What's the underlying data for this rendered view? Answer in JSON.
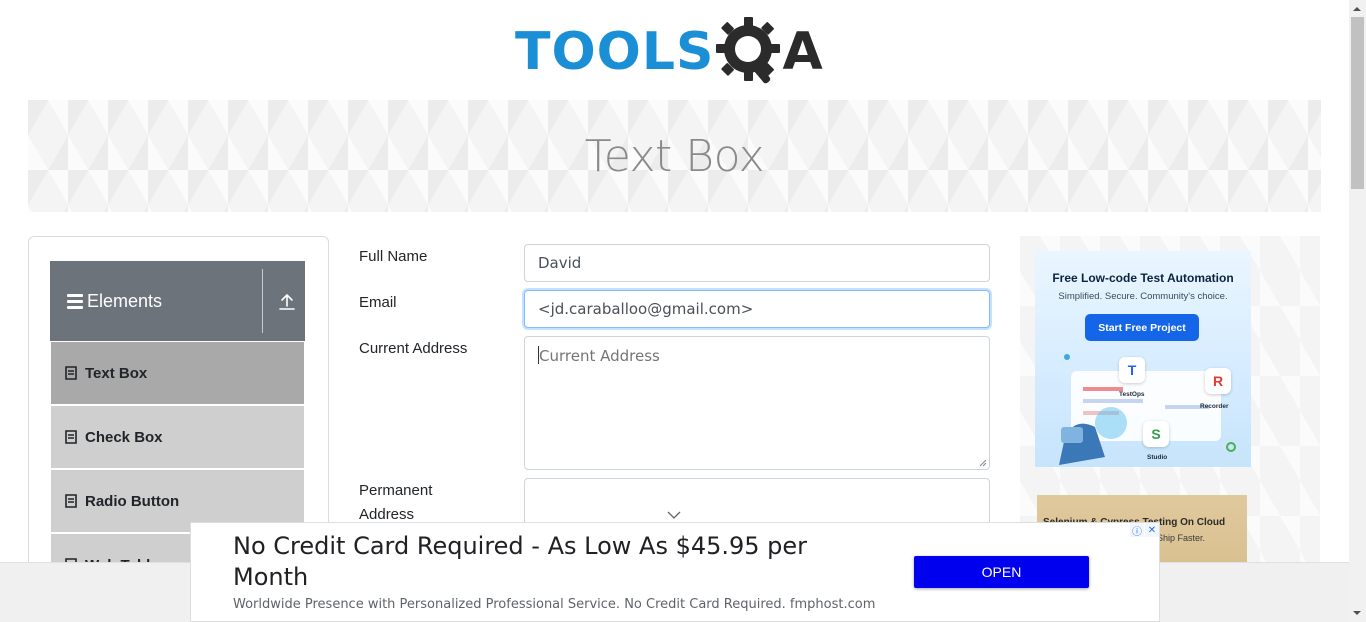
{
  "header": {
    "logo": {
      "text_left": "TOOLS",
      "text_right": "A",
      "icon": "gear-magnifier-icon",
      "colors": {
        "blue": "#1a8fd5",
        "dark": "#2b2b2b"
      }
    }
  },
  "banner": {
    "title": "Text Box"
  },
  "sidebar": {
    "group": {
      "title": "Elements",
      "icon": "hamburger-icon",
      "collapse_icon": "upload-arrow-icon"
    },
    "items": [
      {
        "label": "Text Box",
        "icon": "document-icon",
        "active": true
      },
      {
        "label": "Check Box",
        "icon": "document-icon"
      },
      {
        "label": "Radio Button",
        "icon": "document-icon"
      },
      {
        "label": "Web Tables",
        "icon": "document-icon"
      }
    ]
  },
  "form": {
    "full_name": {
      "label": "Full Name",
      "value": "David"
    },
    "email": {
      "label": "Email",
      "value": "<jd.caraballoo@gmail.com>"
    },
    "current_address": {
      "label": "Current Address",
      "placeholder": "Current Address",
      "value": ""
    },
    "permanent_address": {
      "label_line1": "Permanent",
      "label_line2": "Address",
      "value": ""
    }
  },
  "ads": {
    "side1": {
      "title": "Free Low-code Test Automation",
      "subtitle": "Simplified. Secure. Community's choice.",
      "button": "Start Free Project",
      "tiles": [
        "TestOps",
        "Recorder",
        "Studio"
      ],
      "colors": {
        "button": "#1565e8"
      }
    },
    "side2": {
      "title": "Selenium & Cypress Testing On Cloud",
      "subtitle": "Ship Faster."
    },
    "bottom": {
      "title": "No Credit Card Required - As Low As $45.95 per Month",
      "description": "Worldwide Presence with Personalized Professional Service. No Credit Card Required. fmphost.com",
      "cta": "OPEN",
      "colors": {
        "cta": "#0000ee"
      }
    }
  }
}
